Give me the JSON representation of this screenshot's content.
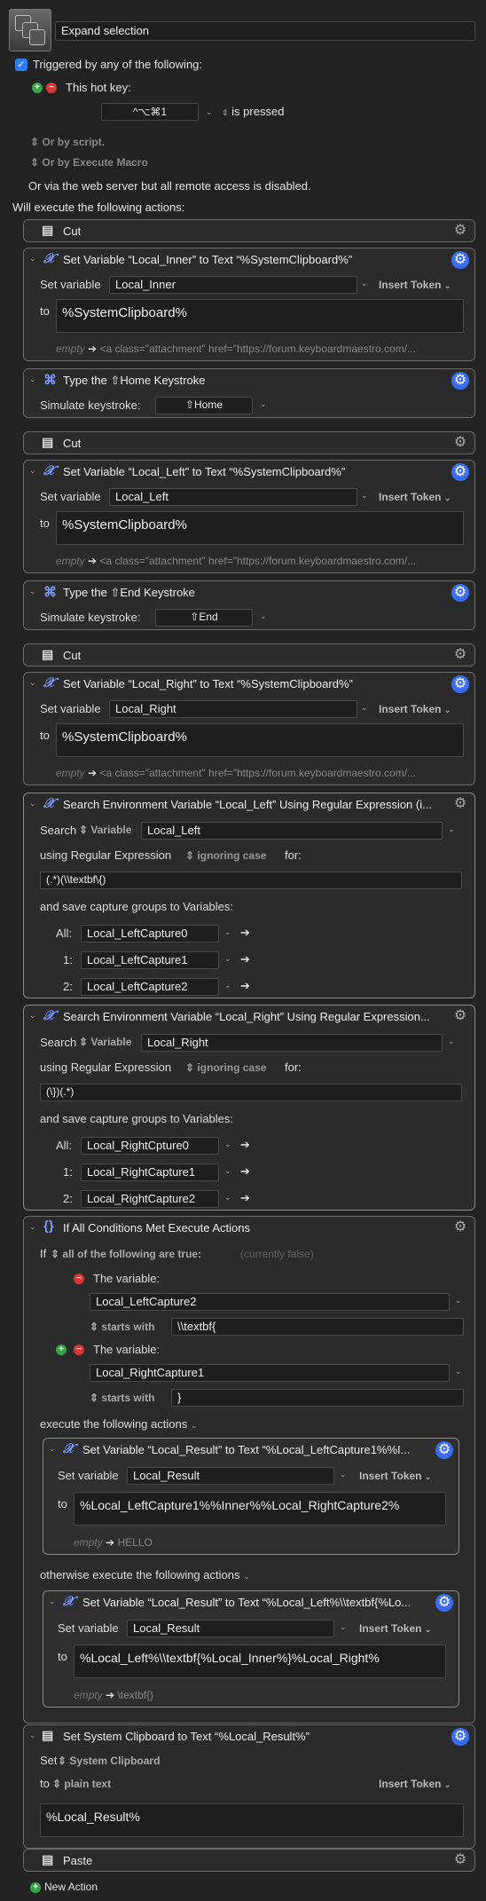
{
  "macro": {
    "name": "Expand selection",
    "triggered_label": "Triggered by any of the following:",
    "hotkey_label": "This hot key:",
    "hotkey_value": "^⌥⌘1",
    "hotkey_state": "is pressed",
    "by_script": "Or by script.",
    "by_execute": "Or by Execute Macro",
    "web_server": "Or via the web server but all remote access is disabled.",
    "will_execute": "Will execute the following actions:"
  },
  "common": {
    "set_variable": "Set variable",
    "insert_token": "Insert Token",
    "to": "to",
    "empty": "empty",
    "arrow": "➔",
    "attachment_preview": "<a class=\"attachment\" href=\"https://forum.keyboardmaestro.com/...",
    "simulate_keystroke": "Simulate keystroke:",
    "search": "Search",
    "variable_kw": "Variable",
    "using_regex": "using Regular Expression",
    "ignoring_case": "ignoring case",
    "for": "for:",
    "save_capture": "and save capture groups to Variables:",
    "all": "All:",
    "one": "1:",
    "two": "2:"
  },
  "actions": {
    "cut1": "Cut",
    "setinner": {
      "title": "Set Variable “Local_Inner” to Text “%SystemClipboard%”",
      "var": "Local_Inner",
      "text": "%SystemClipboard%"
    },
    "home": {
      "title": "Type the ⇧Home Keystroke",
      "key": "⇧Home"
    },
    "cut2": "Cut",
    "setleft": {
      "title": "Set Variable “Local_Left” to Text “%SystemClipboard%”",
      "var": "Local_Left",
      "text": "%SystemClipboard%"
    },
    "end": {
      "title": "Type the ⇧End Keystroke",
      "key": "⇧End"
    },
    "cut3": "Cut",
    "setright": {
      "title": "Set Variable “Local_Right” to Text “%SystemClipboard%”",
      "var": "Local_Right",
      "text": "%SystemClipboard%"
    },
    "searchleft": {
      "title": "Search Environment Variable “Local_Left” Using Regular Expression (i...",
      "var": "Local_Left",
      "regex": "(.*)(\\\\textbf\\{)",
      "cap0": "Local_LeftCapture0",
      "cap1": "Local_LeftCapture1",
      "cap2": "Local_LeftCapture2"
    },
    "searchright": {
      "title": "Search Environment Variable “Local_Right” Using Regular Expression...",
      "var": "Local_Right",
      "regex": "(\\})(.*)",
      "cap0": "Local_RightCpture0",
      "cap1": "Local_RightCapture1",
      "cap2": "Local_RightCapture2"
    },
    "ifall": {
      "title": "If All Conditions Met Execute Actions",
      "if_kw": "If",
      "all_following": "all of the following are true:",
      "currently": "(currently false)",
      "the_variable": "The variable:",
      "cond1_var": "Local_LeftCapture2",
      "starts_with": "starts with",
      "cond1_val": "\\\\textbf{",
      "cond2_var": "Local_RightCapture1",
      "cond2_val": "}",
      "execute_following": "execute the following actions",
      "otherwise": "otherwise execute the following actions"
    },
    "setresult1": {
      "title": "Set Variable “Local_Result” to Text “%Local_LeftCapture1%%I...",
      "var": "Local_Result",
      "text": "%Local_LeftCapture1%%Inner%%Local_RightCapture2%",
      "preview": "HELLO"
    },
    "setresult2": {
      "title": "Set Variable “Local_Result” to Text “%Local_Left%\\\\textbf{%Lo...",
      "var": "Local_Result",
      "text": "%Local_Left%\\\\textbf{%Local_Inner%}%Local_Right%",
      "preview": "\\textbf{}"
    },
    "setclip": {
      "title": "Set System Clipboard to Text “%Local_Result%”",
      "set_kw": "Set",
      "clipboard": "System Clipboard",
      "to_kw": "to",
      "plain": "plain text",
      "text": "%Local_Result%"
    },
    "paste": "Paste"
  },
  "footer": {
    "new_action": "New Action"
  }
}
